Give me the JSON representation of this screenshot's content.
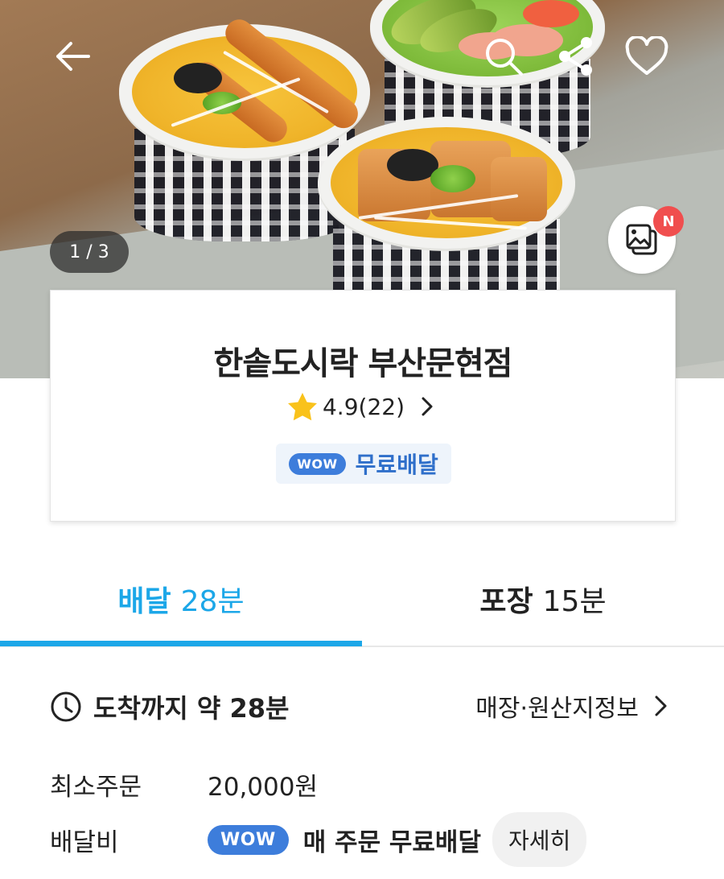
{
  "hero": {
    "image_counter": "1 / 3",
    "new_badge": "N"
  },
  "icons": {
    "back": "arrow-left-icon",
    "search": "search-icon",
    "share": "share-icon",
    "favorite": "heart-icon",
    "photos": "photo-gallery-icon",
    "rating": "star-icon",
    "chevron": "chevron-right-icon",
    "clock": "clock-icon"
  },
  "store": {
    "name": "한솥도시락 부산문현점",
    "rating": "4.9(22)",
    "wow_pill": "WOW",
    "free_delivery": "무료배달"
  },
  "tabs": [
    {
      "label": "배달",
      "time": "28분",
      "active": true
    },
    {
      "label": "포장",
      "time": "15분",
      "active": false
    }
  ],
  "info": {
    "eta": "도착까지 약 28분",
    "store_info_link": "매장·원산지정보",
    "min_order_label": "최소주문",
    "min_order_value": "20,000원",
    "delivery_fee_label": "배달비",
    "delivery_fee_wow": "WOW",
    "delivery_fee_text": "매 주문 무료배달",
    "detail_button": "자세히"
  },
  "colors": {
    "accent": "#1ca7e8",
    "wow": "#3d7ddb",
    "new_badge": "#f04e4e"
  }
}
